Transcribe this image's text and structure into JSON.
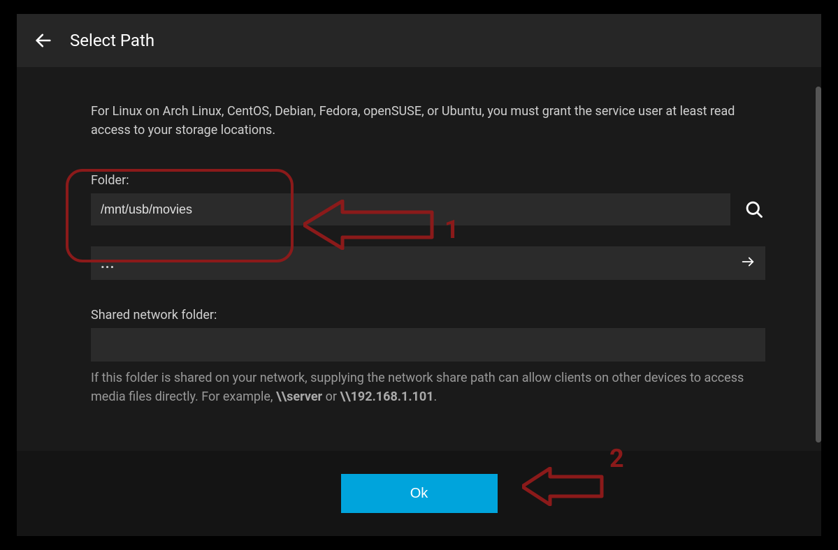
{
  "header": {
    "title": "Select Path"
  },
  "body": {
    "info_text": "For Linux on Arch Linux, CentOS, Debian, Fedora, openSUSE, or Ubuntu, you must grant the service user at least read access to your storage locations.",
    "folder_label": "Folder:",
    "folder_value": "/mnt/usb/movies",
    "nav_dots": "...",
    "shared_label": "Shared network folder:",
    "shared_value": "",
    "help_prefix": "If this folder is shared on your network, supplying the network share path can allow clients on other devices to access media files directly. For example, ",
    "help_ex1": "\\\\server",
    "help_or": " or ",
    "help_ex2": "\\\\192.168.1.101",
    "help_suffix": "."
  },
  "footer": {
    "ok_label": "Ok"
  },
  "annotations": {
    "label1": "1",
    "label2": "2"
  }
}
